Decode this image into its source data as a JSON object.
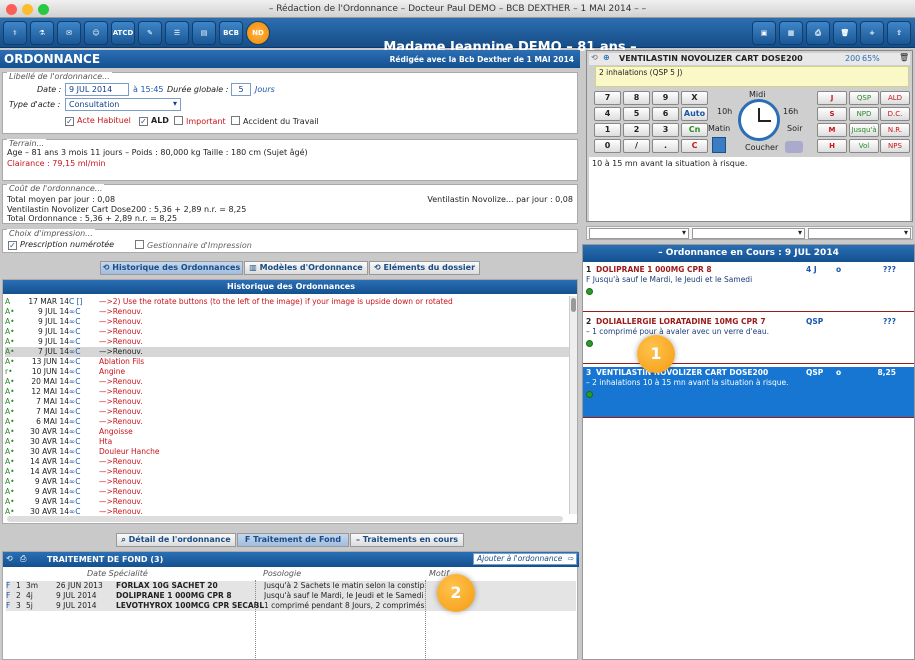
{
  "window_title": "– Rédaction de l'Ordonnance – Docteur Paul DEMO – BCB DEXTHER – 1 MAI 2014 – –",
  "toolbar": {
    "atcd": "ATCD",
    "bcb": "BCB",
    "nd": "ND",
    "patient": "Madame Jeannine DEMO – 81 ans  –"
  },
  "ordonnance": {
    "title": "ORDONNANCE",
    "subtitle": "Rédigée avec la Bcb Dexther de 1 MAI 2014",
    "libelle_legend": "Libellé de l'ordonnance...",
    "date_label": "Date :",
    "date_value": "9 JUL 2014",
    "time_text": "à 15:45",
    "duree_label": "Durée globale :",
    "duree_value": "5",
    "duree_unit": "Jours",
    "type_label": "Type d'acte :",
    "type_value": "Consultation",
    "acte_habituel": "Acte Habituel",
    "ald": "ALD",
    "important": "Important",
    "accident": "Accident du Travail"
  },
  "terrain": {
    "legend": "Terrain...",
    "line1": "Age – 81 ans 3 mois 11 jours  –  Poids : 80,000 kg Taille : 180 cm (Sujet âgé)",
    "line2": "Clairance : 79,15 ml/min"
  },
  "cout": {
    "legend": "Coût de l'ordonnance...",
    "line1": "Total moyen par jour : 0,08",
    "line1_right": "Ventilastin Novolize... par jour : 0,08",
    "line2": "Ventilastin Novolizer Cart Dose200 : 5,36 + 2,89 n.r. = 8,25",
    "line3": "Total Ordonnance : 5,36 + 2,89 n.r. = 8,25"
  },
  "impression": {
    "legend": "Choix d'impression...",
    "numerotee": "Prescription numérotée",
    "gestionnaire": "Gestionnaire d'Impression"
  },
  "tabs": {
    "historique": "Historique des Ordonnances",
    "modeles": "Modèles d'Ordonnance",
    "elements": "Eléments du dossier"
  },
  "historique": {
    "header": "Historique des Ordonnances",
    "rows": [
      {
        "flag": "A",
        "date": "17 MAR 14",
        "code": "C []",
        "text": "—>2) Use the rotate buttons (to the left of the image) if your image is upside down or rotated",
        "red": true
      },
      {
        "flag": "A•",
        "date": "9 JUL 14",
        "code": "∞C",
        "text": "—>Renouv.",
        "red": true
      },
      {
        "flag": "A•",
        "date": "9 JUL 14",
        "code": "∞C",
        "text": "—>Renouv.",
        "red": true
      },
      {
        "flag": "A•",
        "date": "9 JUL 14",
        "code": "∞C",
        "text": "—>Renouv.",
        "red": true
      },
      {
        "flag": "A•",
        "date": "9 JUL 14",
        "code": "∞C",
        "text": "—>Renouv.",
        "red": true
      },
      {
        "flag": "A•",
        "date": "7 JUL 14",
        "code": "∞C",
        "text": "—>Renouv.",
        "red": false
      },
      {
        "flag": "A•",
        "date": "13 JUN 14",
        "code": "∞C",
        "text": "Ablation Fils",
        "red": true
      },
      {
        "flag": "r•",
        "date": "10 JUN 14",
        "code": "∞C",
        "text": "Angine",
        "red": true
      },
      {
        "flag": "A•",
        "date": "20 MAI 14",
        "code": "∞C",
        "text": "—>Renouv.",
        "red": true
      },
      {
        "flag": "A•",
        "date": "12 MAI 14",
        "code": "∞C",
        "text": "—>Renouv.",
        "red": true
      },
      {
        "flag": "A•",
        "date": "7 MAI 14",
        "code": "∞C",
        "text": "—>Renouv.",
        "red": true
      },
      {
        "flag": "A•",
        "date": "7 MAI 14",
        "code": "∞C",
        "text": "—>Renouv.",
        "red": true
      },
      {
        "flag": "A•",
        "date": "6 MAI 14",
        "code": "∞C",
        "text": "—>Renouv.",
        "red": true
      },
      {
        "flag": "A•",
        "date": "30 AVR 14",
        "code": "∞C",
        "text": "Angoisse",
        "red": true
      },
      {
        "flag": "A•",
        "date": "30 AVR 14",
        "code": "∞C",
        "text": "Hta",
        "red": true
      },
      {
        "flag": "A•",
        "date": "30 AVR 14",
        "code": "∞C",
        "text": "Douleur Hanche",
        "red": true
      },
      {
        "flag": "A•",
        "date": "14 AVR 14",
        "code": "∞C",
        "text": "—>Renouv.",
        "red": true
      },
      {
        "flag": "A•",
        "date": "14 AVR 14",
        "code": "∞C",
        "text": "—>Renouv.",
        "red": true
      },
      {
        "flag": "A•",
        "date": "9 AVR 14",
        "code": "∞C",
        "text": "—>Renouv.",
        "red": true
      },
      {
        "flag": "A•",
        "date": "9 AVR 14",
        "code": "∞C",
        "text": "—>Renouv.",
        "red": true
      },
      {
        "flag": "A•",
        "date": "9 AVR 14",
        "code": "∞C",
        "text": "—>Renouv.",
        "red": true
      },
      {
        "flag": "A•",
        "date": "30 AVR 14",
        "code": "∞C",
        "text": "—>Renouv.",
        "red": true
      }
    ]
  },
  "bottom_tabs": {
    "detail": "Détail de l'ordonnance",
    "fond": "Traitement de Fond",
    "encours": "Traitements en cours"
  },
  "fond": {
    "header": "TRAITEMENT DE FOND (3)",
    "add_button": "Ajouter à l'ordonnance",
    "col_date": "Date Spécialité",
    "col_posologie": "Posologie",
    "col_motif": "Motif",
    "rows": [
      {
        "f": "F",
        "n": "1",
        "dur": "3m",
        "date": "26 JUN 2013",
        "name": "FORLAX 10G SACHET 20",
        "poso": "Jusqu'à 2 Sachets le matin selon  la constip"
      },
      {
        "f": "F",
        "n": "2",
        "dur": "4j",
        "date": "9 JUL 2014",
        "name": "DOLIPRANE 1 000MG CPR 8",
        "poso": "Jusqu'à  sauf le Mardi, le Jeudi et le Samedi"
      },
      {
        "f": "F",
        "n": "3",
        "dur": "5j",
        "date": "9 JUL 2014",
        "name": "LEVOTHYROX 100MCG CPR SECABLE",
        "poso": "1 comprimé pendant 8 Jours, 2 comprimés"
      }
    ]
  },
  "editor": {
    "drug": "VENTILASTIN NOVOLIZER CART DOSE200",
    "count": "200",
    "pct": "65%",
    "text": "2 inhalations (QSP 5 J)",
    "keys": [
      "7",
      "8",
      "9",
      "X",
      "4",
      "5",
      "6",
      "Auto",
      "1",
      "2",
      "3",
      "Cn",
      "0",
      "/",
      ".",
      "C"
    ],
    "clock_midi": "Midi",
    "clock_10h": "10h",
    "clock_16h": "16h",
    "clock_matin": "Matin",
    "clock_soir": "Soir",
    "clock_coucher": "Coucher",
    "side_buttons": [
      "J",
      "S",
      "M",
      "H"
    ],
    "flags": [
      "QSP",
      "ALD",
      "NPD",
      "D.C.",
      "Jusqu'à",
      "N.R.",
      "Vol",
      "NPS"
    ],
    "instruction": "10 à 15 mn avant la situation à risque."
  },
  "encours": {
    "header": "– Ordonnance en Cours : 9 JUL 2014",
    "items": [
      {
        "num": "1",
        "name": "DOLIPRANE 1 000MG CPR 8",
        "qty": "4 J",
        "flag": "o",
        "price": "???",
        "line": "F   Jusqu'à  sauf le Mardi, le Jeudi et le Samedi",
        "selected": false
      },
      {
        "num": "2",
        "name": "DOLIALLERGIE LORATADINE 10MG CPR 7",
        "qty": "QSP",
        "flag": "",
        "price": "???",
        "line": "–   1 comprimé pour    à avaler avec un verre d'eau.",
        "selected": false
      },
      {
        "num": "3",
        "name": "VENTILASTIN NOVOLIZER CART DOSE200",
        "qty": "QSP",
        "flag": "o",
        "price": "8,25",
        "line": "–   2 inhalations 10 à 15 mn avant la situation à risque.",
        "selected": true
      }
    ]
  },
  "badges": {
    "one": "1",
    "two": "2"
  },
  "colors": {
    "blue": "#1a5c9e",
    "red": "#c8151a",
    "selected": "#1676d2",
    "badge": "#f5a623"
  }
}
